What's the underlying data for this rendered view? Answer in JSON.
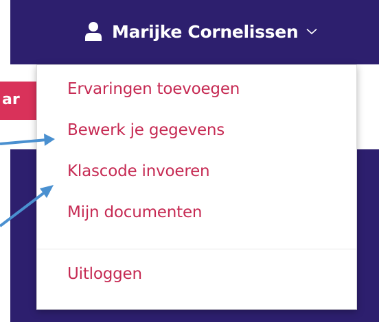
{
  "header": {
    "user_name": "Marijke Cornelissen",
    "user_icon": "user-icon",
    "chevron_icon": "chevron-down-icon"
  },
  "side_button": {
    "label_fragment": "ar"
  },
  "dropdown": {
    "items": [
      {
        "label": "Ervaringen toevoegen"
      },
      {
        "label": "Bewerk je gegevens"
      },
      {
        "label": "Klascode invoeren"
      },
      {
        "label": "Mijn documenten"
      }
    ],
    "logout_label": "Uitloggen"
  },
  "colors": {
    "navy": "#2d1f6e",
    "menu_text": "#c62a53",
    "button_red": "#d9325a",
    "arrow_blue": "#4a90d0"
  }
}
